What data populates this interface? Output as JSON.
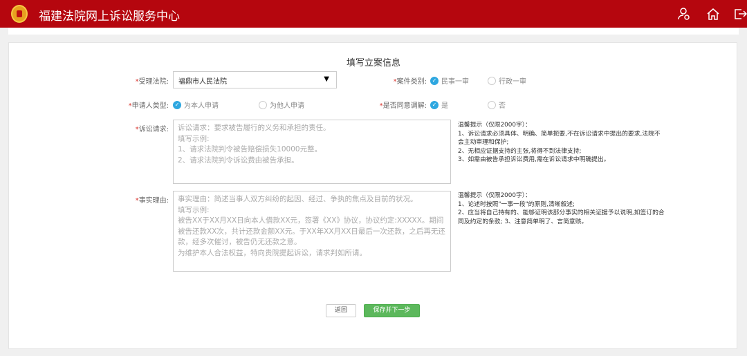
{
  "header": {
    "title": "福建法院网上诉讼服务中心",
    "icons": [
      "user-settings-icon",
      "home-icon",
      "logout-icon"
    ]
  },
  "form": {
    "title": "填写立案信息",
    "court": {
      "label": "受理法院:",
      "value": "福鼎市人民法院"
    },
    "case_type": {
      "label": "案件类别:",
      "options": [
        {
          "label": "民事一审",
          "checked": true
        },
        {
          "label": "行政一审",
          "checked": false
        }
      ]
    },
    "applicant_type": {
      "label": "申请人类型:",
      "options": [
        {
          "label": "为本人申请",
          "checked": true
        },
        {
          "label": "为他人申请",
          "checked": false
        }
      ]
    },
    "mediation": {
      "label": "是否同意调解:",
      "options": [
        {
          "label": "是",
          "checked": true
        },
        {
          "label": "否",
          "checked": false
        }
      ]
    },
    "claims": {
      "label": "诉讼请求:",
      "placeholder": "诉讼请求：要求被告履行的义务和承担的责任。\n填写示例:\n1、请求法院判令被告赔偿损失10000元整。\n2、请求法院判令诉讼费由被告承担。",
      "tip": "温馨提示（仅限2000字）：\n1、诉讼请求必须具体、明确、简单扼要,不在诉讼请求中提出的要求,法院不会主动审理和保护;\n2、无相应证据支持的主张,将得不到法律支持;\n3、如需由被告承担诉讼费用,需在诉讼请求中明确提出。"
    },
    "facts": {
      "label": "事实理由:",
      "placeholder": "事实理由：简述当事人双方纠纷的起因、经过、争执的焦点及目前的状况。\n填写示例:\n被告XX于XX月XX日向本人借款XX元，签署《XX》协议，协议约定:XXXXX。期间被告还款XX次，共计还款金额XX元。于XX年XX月XX日最后一次还款，之后再无还款，经多次催讨，被告仍无还款之意。\n为维护本人合法权益，特向贵院提起诉讼，请求判如所请。",
      "tip": "温馨提示（仅限2000字）：\n1、论述时按照\"一事一段\"的原则,清晰叙述;\n2、应当将自己持有的、能够证明该部分事实的相关证据予以说明,如签订的合同及约定的条款; 3、注意简单明了、言简意赅。"
    },
    "buttons": {
      "back": "返回",
      "save_next": "保存并下一步"
    }
  },
  "colors": {
    "header": "#b5060e",
    "accent": "#2ea7e0",
    "primary_button": "#5cb85c"
  }
}
